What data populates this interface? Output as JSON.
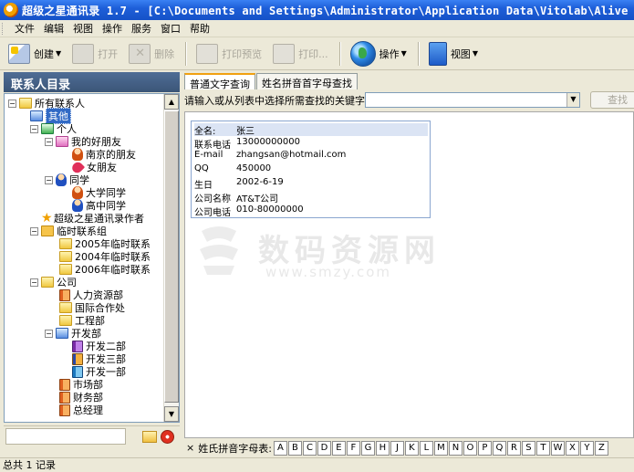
{
  "window": {
    "title": "超级之星通讯录 1.7 - [C:\\Documents and Settings\\Administrator\\Application Data\\Vitolab\\Alive Addre"
  },
  "menu": {
    "items": [
      "文件",
      "编辑",
      "视图",
      "操作",
      "服务",
      "窗口",
      "帮助"
    ]
  },
  "toolbar": {
    "create": "创建",
    "open": "打开",
    "delete": "删除",
    "preview": "打印预览",
    "print": "打印...",
    "operate": "操作",
    "view": "视图"
  },
  "left": {
    "header": "联系人目录",
    "tree": {
      "all": "所有联系人",
      "other": "其他",
      "personal": "个人",
      "friends": "我的好朋友",
      "nanjing": "南京的朋友",
      "girlfriend": "女朋友",
      "classmates": "同学",
      "university": "大学同学",
      "highschool": "高中同学",
      "author": "超级之星通讯录作者",
      "temp": "临时联系组",
      "temp2005": "2005年临时联系",
      "temp2004": "2004年临时联系",
      "temp2006": "2006年临时联系",
      "company": "公司",
      "hr": "人力资源部",
      "intl": "国际合作处",
      "eng": "工程部",
      "dev": "开发部",
      "dev2": "开发二部",
      "dev3": "开发三部",
      "dev1": "开发一部",
      "market": "市场部",
      "finance": "财务部",
      "gm": "总经理"
    }
  },
  "tabs": [
    "普通文字查询",
    "姓名拼音首字母查找"
  ],
  "search": {
    "label": "请输入或从列表中选择所需查找的关键字:",
    "value": "",
    "find_label": "查找"
  },
  "card": {
    "rows": [
      {
        "key": "全名:",
        "value": "张三"
      },
      {
        "key": "联系电话",
        "value": "13000000000"
      },
      {
        "key": "E-mail",
        "value": "zhangsan@hotmail.com"
      },
      {
        "key": "QQ",
        "value": "450000"
      },
      {
        "key": "生日",
        "value": "2002-6-19"
      },
      {
        "key": "公司名称",
        "value": "AT&T公司"
      },
      {
        "key": "公司电话",
        "value": "010-80000000"
      }
    ]
  },
  "watermark": {
    "text": "数码资源网",
    "url": "www.smzy.com"
  },
  "alpha": {
    "close": "×",
    "label": "姓氏拼音字母表:",
    "letters": [
      "A",
      "B",
      "C",
      "D",
      "E",
      "F",
      "G",
      "H",
      "J",
      "K",
      "L",
      "M",
      "N",
      "O",
      "P",
      "Q",
      "R",
      "S",
      "T",
      "W",
      "X",
      "Y",
      "Z"
    ]
  },
  "status": {
    "text": "总共 1 记录"
  }
}
